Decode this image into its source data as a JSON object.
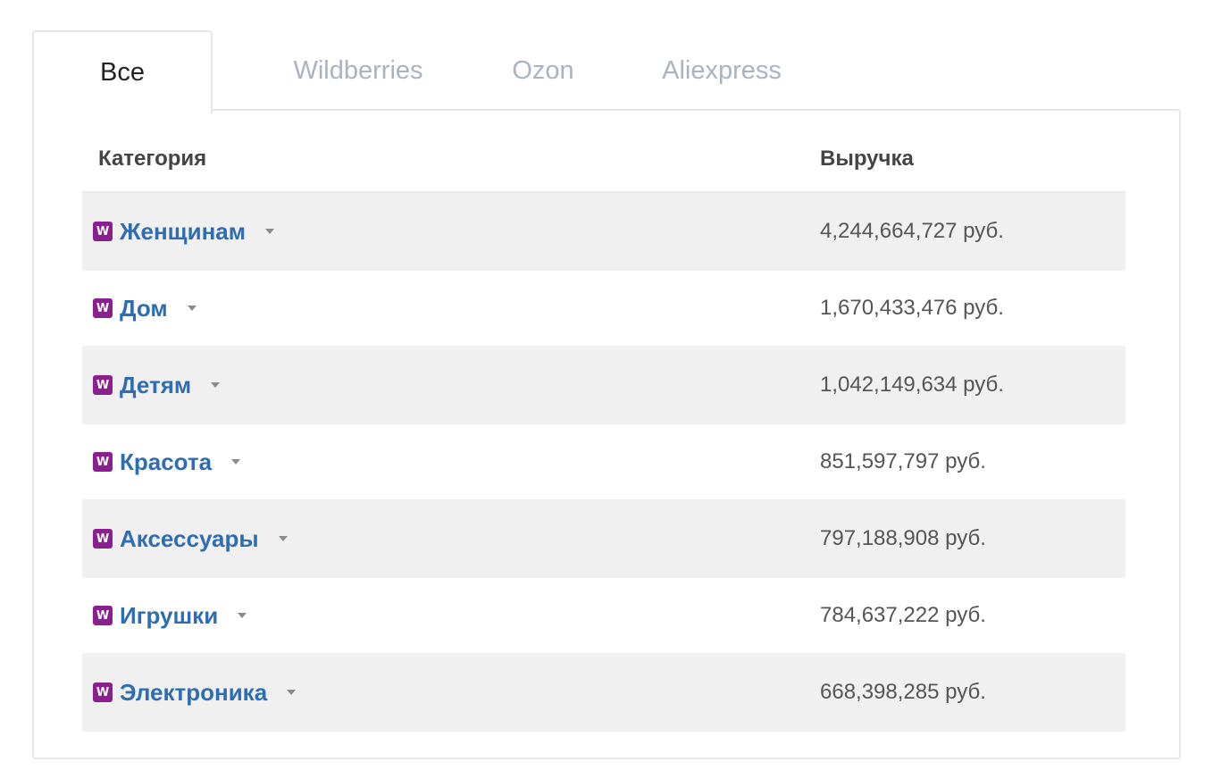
{
  "tabs": [
    {
      "label": "Все",
      "active": true
    },
    {
      "label": "Wildberries",
      "active": false
    },
    {
      "label": "Ozon",
      "active": false
    },
    {
      "label": "Aliexpress",
      "active": false
    }
  ],
  "table": {
    "headers": {
      "category": "Категория",
      "revenue": "Выручка"
    },
    "rows": [
      {
        "icon": "wildberries-logo-icon",
        "icon_letter": "W",
        "category": "Женщинам",
        "revenue": "4,244,664,727 руб."
      },
      {
        "icon": "wildberries-logo-icon",
        "icon_letter": "W",
        "category": "Дом",
        "revenue": "1,670,433,476 руб."
      },
      {
        "icon": "wildberries-logo-icon",
        "icon_letter": "W",
        "category": "Детям",
        "revenue": "1,042,149,634 руб."
      },
      {
        "icon": "wildberries-logo-icon",
        "icon_letter": "W",
        "category": "Красота",
        "revenue": "851,597,797 руб."
      },
      {
        "icon": "wildberries-logo-icon",
        "icon_letter": "W",
        "category": "Аксессуары",
        "revenue": "797,188,908 руб."
      },
      {
        "icon": "wildberries-logo-icon",
        "icon_letter": "W",
        "category": "Игрушки",
        "revenue": "784,637,222 руб."
      },
      {
        "icon": "wildberries-logo-icon",
        "icon_letter": "W",
        "category": "Электроника",
        "revenue": "668,398,285 руб."
      }
    ]
  },
  "colors": {
    "link": "#2f6db3",
    "wildberries_brand": "#8a1f8f",
    "row_stripe": "#f0f0f0",
    "inactive_tab": "#a9b3c1"
  }
}
